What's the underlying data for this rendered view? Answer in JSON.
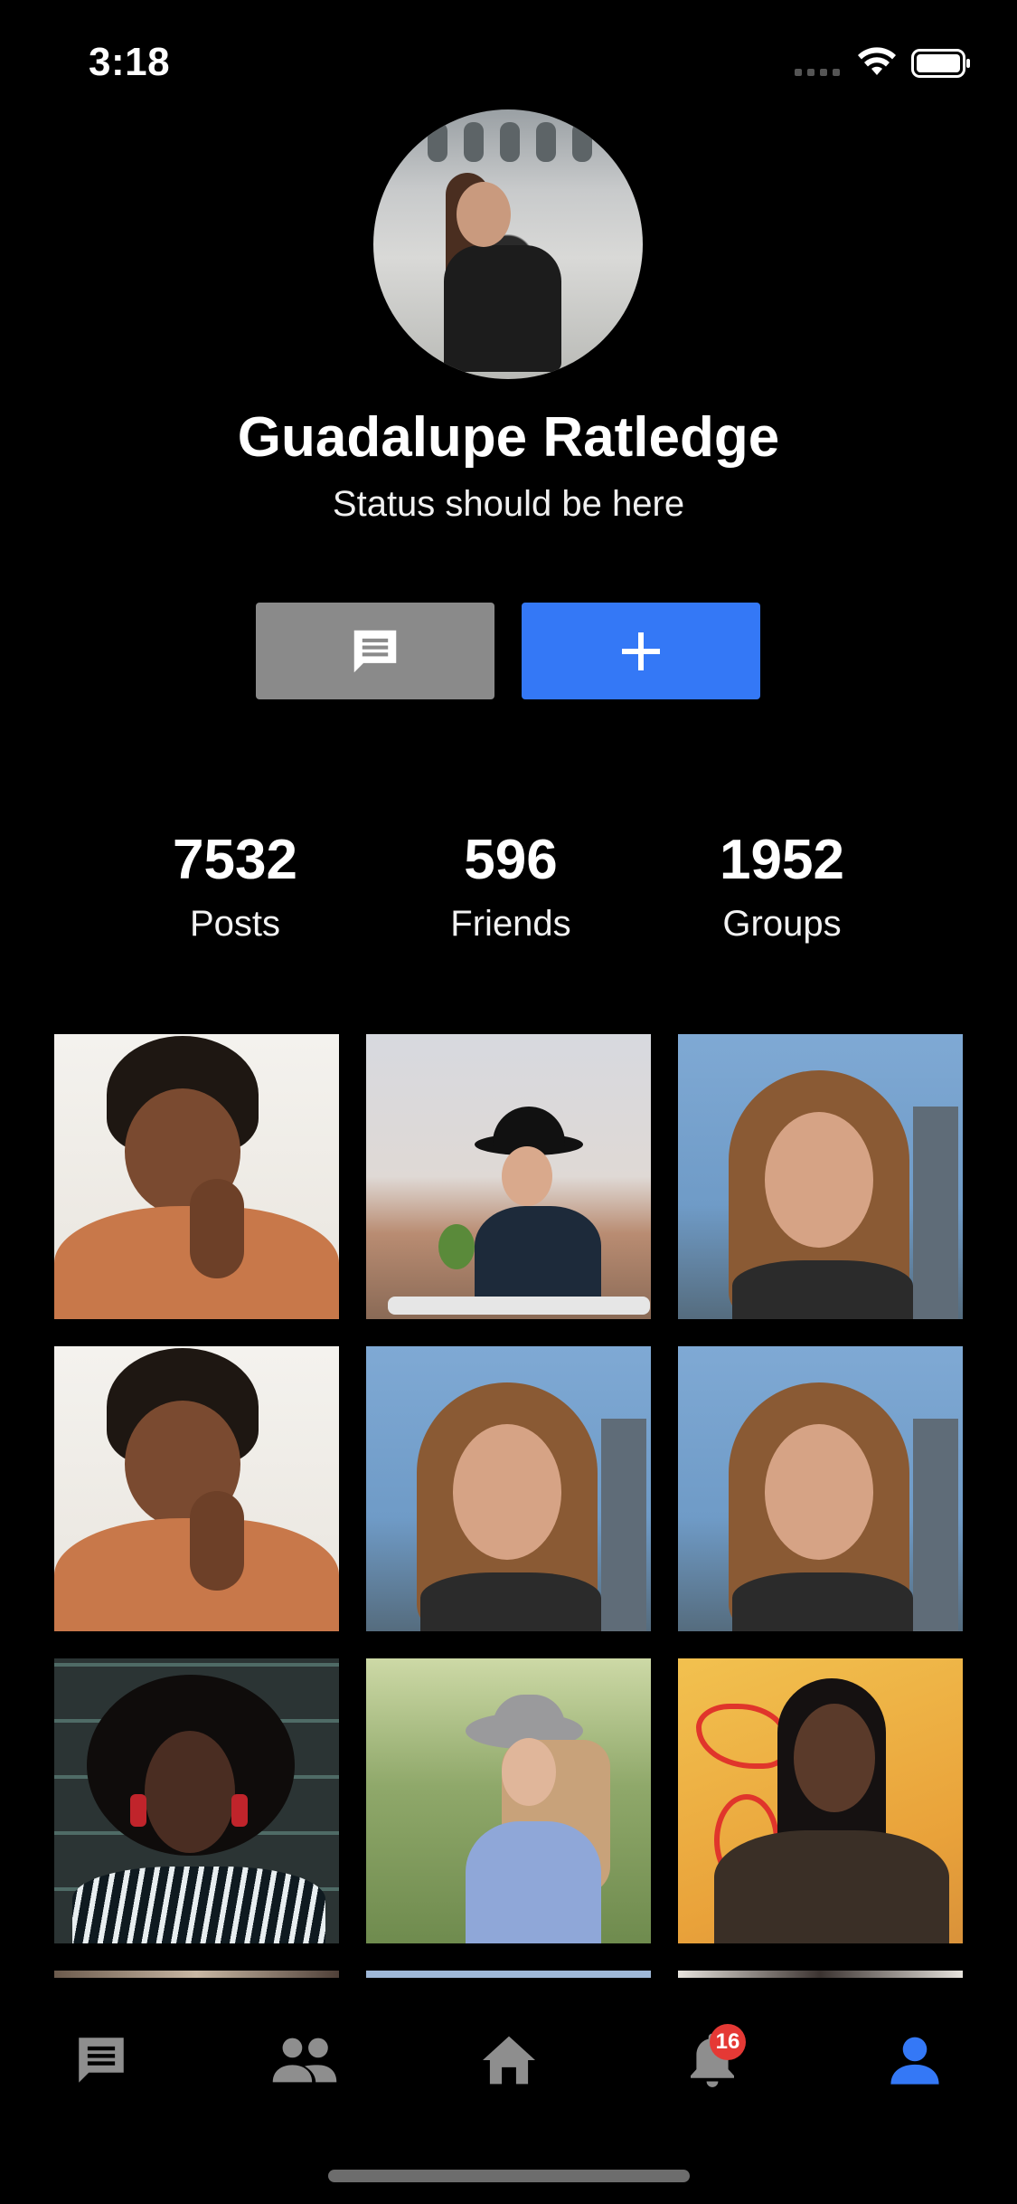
{
  "status_bar": {
    "time": "3:18"
  },
  "profile": {
    "name": "Guadalupe Ratledge",
    "status": "Status should be here"
  },
  "actions": {
    "message_icon": "message-icon",
    "add_icon": "plus-icon",
    "colors": {
      "message_bg": "#8a8a8a",
      "add_bg": "#3478f6"
    }
  },
  "stats": [
    {
      "value": "7532",
      "label": "Posts"
    },
    {
      "value": "596",
      "label": "Friends"
    },
    {
      "value": "1952",
      "label": "Groups"
    }
  ],
  "photos": [
    "photo-smiling-woman-orange-sweater",
    "photo-woman-black-hat-rooftop",
    "photo-woman-long-hair-blue-sky",
    "photo-smiling-woman-orange-sweater",
    "photo-woman-long-hair-blue-sky",
    "photo-woman-long-hair-blue-sky",
    "photo-woman-brick-wall",
    "photo-woman-grey-hat-field",
    "photo-woman-graffiti-wall"
  ],
  "tabbar": {
    "items": [
      {
        "icon": "chat-icon",
        "active": false
      },
      {
        "icon": "people-icon",
        "active": false
      },
      {
        "icon": "home-icon",
        "active": false
      },
      {
        "icon": "bell-icon",
        "active": false,
        "badge": "16"
      },
      {
        "icon": "person-icon",
        "active": true
      }
    ],
    "active_color": "#3478f6",
    "inactive_color": "#8e8e8e",
    "badge_color": "#e53935"
  }
}
